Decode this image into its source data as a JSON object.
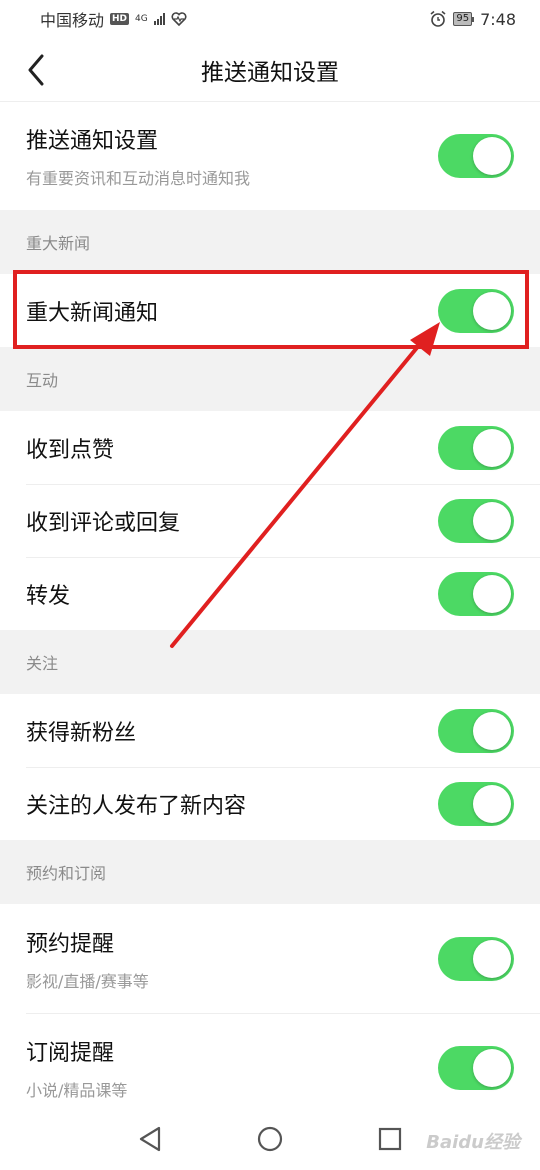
{
  "status_bar": {
    "carrier": "中国移动",
    "hd": "HD",
    "network": "4G",
    "battery": "95",
    "time": "7:48"
  },
  "nav": {
    "title": "推送通知设置"
  },
  "main_setting": {
    "label": "推送通知设置",
    "sub": "有重要资讯和互动消息时通知我",
    "on": true
  },
  "sections": {
    "major_news": {
      "title": "重大新闻",
      "items": [
        {
          "label": "重大新闻通知",
          "on": true
        }
      ]
    },
    "interaction": {
      "title": "互动",
      "items": [
        {
          "label": "收到点赞",
          "on": true
        },
        {
          "label": "收到评论或回复",
          "on": true
        },
        {
          "label": "转发",
          "on": true
        }
      ]
    },
    "follow": {
      "title": "关注",
      "items": [
        {
          "label": "获得新粉丝",
          "on": true
        },
        {
          "label": "关注的人发布了新内容",
          "on": true
        }
      ]
    },
    "subscribe": {
      "title": "预约和订阅",
      "items": [
        {
          "label": "预约提醒",
          "sub": "影视/直播/赛事等",
          "on": true
        },
        {
          "label": "订阅提醒",
          "sub": "小说/精品课等",
          "on": true
        }
      ]
    }
  },
  "colors": {
    "toggle_on": "#4cd964",
    "annotation_red": "#e02020",
    "section_bg": "#f2f2f2"
  },
  "watermark": "Baidu经验"
}
